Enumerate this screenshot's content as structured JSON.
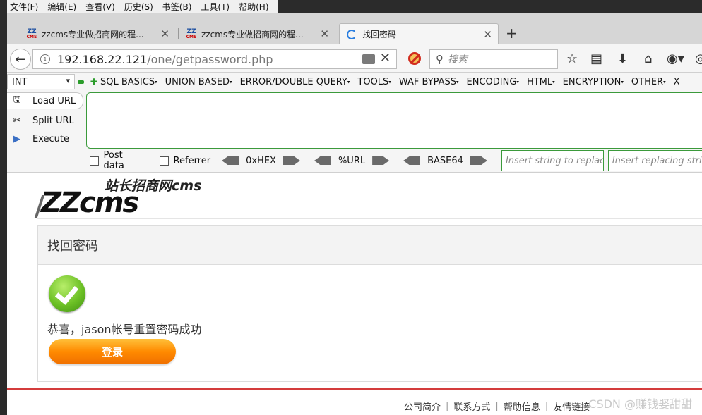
{
  "menubar": [
    "文件(F)",
    "编辑(E)",
    "查看(V)",
    "历史(S)",
    "书签(B)",
    "工具(T)",
    "帮助(H)"
  ],
  "tabs": [
    {
      "title": "zzcms专业做招商网的程..."
    },
    {
      "title": "zzcms专业做招商网的程..."
    },
    {
      "title": "找回密码"
    }
  ],
  "tab_close": "✕",
  "new_tab": "+",
  "nav": {
    "url_host": "192.168.22.121",
    "url_path": "/one/getpassword.php",
    "search_placeholder": "搜索"
  },
  "hackbar": {
    "select_value": "INT",
    "menus": [
      "SQL BASICS",
      "UNION BASED",
      "ERROR/DOUBLE QUERY",
      "TOOLS",
      "WAF BYPASS",
      "ENCODING",
      "HTML",
      "ENCRYPTION",
      "OTHER",
      "X"
    ],
    "load_url": "Load URL",
    "split_url": "Split URL",
    "execute": "Execute",
    "post_data": "Post data",
    "referrer": "Referrer",
    "hex": "0xHEX",
    "url": "%URL",
    "base64": "BASE64",
    "replace_placeholder": "Insert string to replace",
    "replacing_placeholder": "Insert replacing string"
  },
  "page": {
    "logo_cn": "站长招商网cms",
    "logo_main": "ZZcms",
    "panel_title": "找回密码",
    "message": "恭喜，jason帐号重置密码成功",
    "login_button": "登录",
    "footer_links": [
      "公司简介",
      "联系方式",
      "帮助信息",
      "友情链接"
    ]
  },
  "watermark": "CSDN @赚钱娶甜甜"
}
